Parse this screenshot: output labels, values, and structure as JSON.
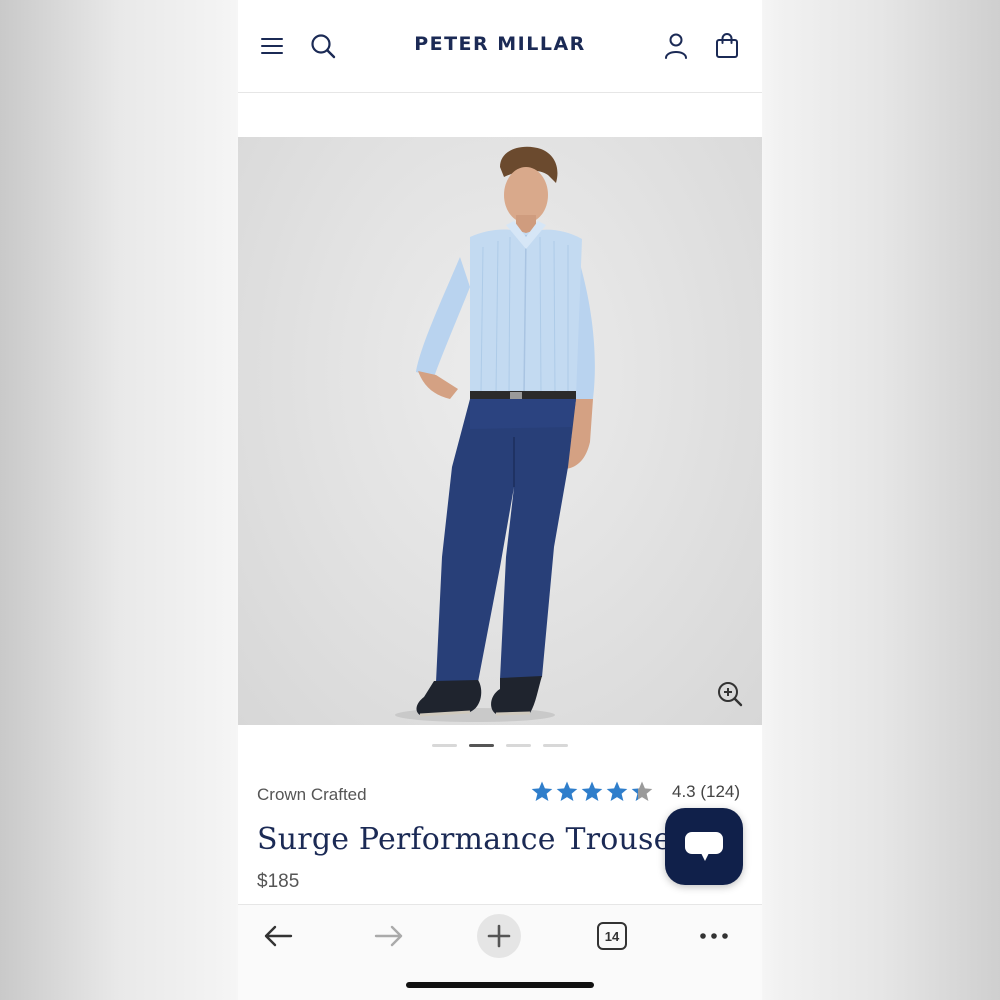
{
  "header": {
    "brand_logo": "PETER MILLAR",
    "icons": [
      "menu-icon",
      "search-icon",
      "account-icon",
      "shopping-bag-icon"
    ]
  },
  "product": {
    "collection": "Crown Crafted",
    "name": "Surge Performance Trouser",
    "price": "$185",
    "rating_value": 4.3,
    "rating_text": "4.3 (124)",
    "stars_total": 5,
    "image_count": 4,
    "image_active_index": 1
  },
  "colors": {
    "brand_navy": "#1b2a55",
    "star_blue": "#2f7ecb",
    "chat_bg": "#10204a"
  },
  "browser_toolbar": {
    "tab_count": "14",
    "icons": [
      "back-arrow-icon",
      "forward-arrow-icon",
      "new-tab-plus-icon",
      "tabs-icon",
      "more-icon"
    ]
  }
}
